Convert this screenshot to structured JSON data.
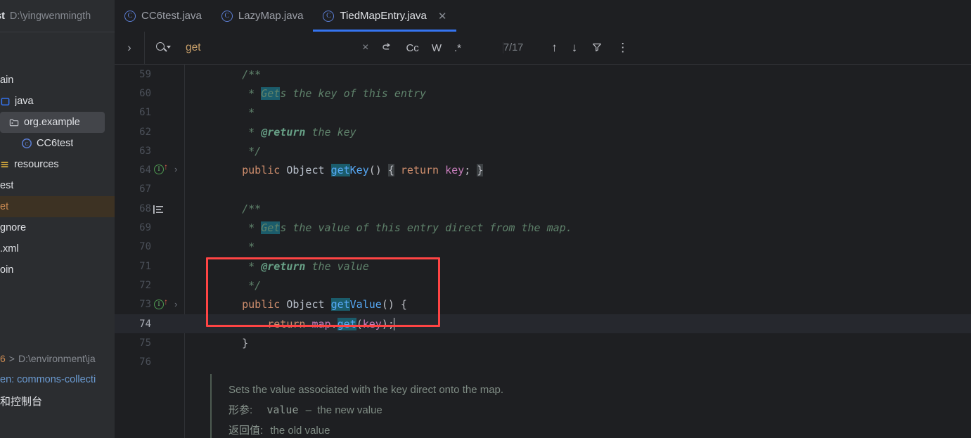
{
  "sidebar": {
    "project_name": "st",
    "project_path": "D:\\yingwenmingth",
    "tree": [
      {
        "label": "ain",
        "icon": "none",
        "indent": 1,
        "state": "normal"
      },
      {
        "label": "java",
        "icon": "source-root",
        "indent": 1,
        "state": "normal"
      },
      {
        "label": "org.example",
        "icon": "package",
        "indent": 2,
        "state": "selected"
      },
      {
        "label": "CC6test",
        "icon": "java-class",
        "indent": 3,
        "state": "normal"
      },
      {
        "label": "resources",
        "icon": "resource-root",
        "indent": 1,
        "state": "normal"
      },
      {
        "label": "est",
        "icon": "none",
        "indent": 1,
        "state": "normal"
      },
      {
        "label": "et",
        "icon": "none",
        "indent": 1,
        "state": "highlighted"
      },
      {
        "label": "gnore",
        "icon": "none",
        "indent": 1,
        "state": "normal"
      },
      {
        "label": ".xml",
        "icon": "none",
        "indent": 1,
        "state": "normal"
      },
      {
        "label": "oin",
        "icon": "none",
        "indent": 1,
        "state": "normal"
      }
    ],
    "run_line": {
      "num": "6",
      "arrow": ">",
      "path": "D:\\environment\\ja"
    },
    "maven_line": "en: commons-collecti",
    "console_line": "和控制台"
  },
  "tabs": [
    {
      "label": "CC6test.java",
      "icon": "java-class-icon",
      "active": false,
      "closable": false
    },
    {
      "label": "LazyMap.java",
      "icon": "java-class-icon",
      "active": false,
      "closable": false
    },
    {
      "label": "TiedMapEntry.java",
      "icon": "java-class-icon",
      "active": true,
      "closable": true
    }
  ],
  "search": {
    "expand_label": "›",
    "query": "get",
    "placeholder": "",
    "clear_label": "×",
    "wrap_label": "wrap-around",
    "match_case_label": "Cc",
    "whole_words_label": "W",
    "regex_label": ".*",
    "match_count": "7/17",
    "prev_label": "↑",
    "next_label": "↓",
    "filter_label": "filter",
    "more_label": "⋮"
  },
  "editor": {
    "lines": [
      {
        "num": "59",
        "gutter": "none",
        "tokens": [
          {
            "t": "    ",
            "c": "pun"
          },
          {
            "t": "/**",
            "c": "cmt"
          }
        ]
      },
      {
        "num": "60",
        "gutter": "none",
        "tokens": [
          {
            "t": "     * ",
            "c": "cmt"
          },
          {
            "t": "Get",
            "c": "cmt hl"
          },
          {
            "t": "s the key of this entry",
            "c": "cmt"
          }
        ]
      },
      {
        "num": "61",
        "gutter": "none",
        "tokens": [
          {
            "t": "     *",
            "c": "cmt"
          }
        ]
      },
      {
        "num": "62",
        "gutter": "none",
        "tokens": [
          {
            "t": "     * ",
            "c": "cmt"
          },
          {
            "t": "@return",
            "c": "tag"
          },
          {
            "t": " the key",
            "c": "cmt"
          }
        ]
      },
      {
        "num": "63",
        "gutter": "none",
        "tokens": [
          {
            "t": "     */",
            "c": "cmt"
          }
        ]
      },
      {
        "num": "64",
        "gutter": "implemented-method",
        "tokens": [
          {
            "t": "    ",
            "c": "pun"
          },
          {
            "t": "public",
            "c": "kw"
          },
          {
            "t": " ",
            "c": "pun"
          },
          {
            "t": "Object",
            "c": "typ"
          },
          {
            "t": " ",
            "c": "pun"
          },
          {
            "t": "get",
            "c": "mth hl"
          },
          {
            "t": "Key",
            "c": "mth"
          },
          {
            "t": "()",
            "c": "pun"
          },
          {
            "t": " ",
            "c": "pun"
          },
          {
            "t": "{",
            "c": "pun brmatch"
          },
          {
            "t": " ",
            "c": "pun"
          },
          {
            "t": "return",
            "c": "kw"
          },
          {
            "t": " ",
            "c": "pun"
          },
          {
            "t": "key",
            "c": "fld"
          },
          {
            "t": ";",
            "c": "pun"
          },
          {
            "t": " ",
            "c": "pun"
          },
          {
            "t": "}",
            "c": "pun brmatch"
          }
        ]
      },
      {
        "num": "67",
        "gutter": "none",
        "tokens": []
      },
      {
        "num": "68",
        "gutter": "javadoc",
        "tokens": [
          {
            "t": "    ",
            "c": "pun"
          },
          {
            "t": "/**",
            "c": "cmt"
          }
        ]
      },
      {
        "num": "69",
        "gutter": "none",
        "tokens": [
          {
            "t": "     * ",
            "c": "cmt"
          },
          {
            "t": "Get",
            "c": "cmt hl"
          },
          {
            "t": "s the value of this entry direct from the map.",
            "c": "cmt"
          }
        ]
      },
      {
        "num": "70",
        "gutter": "none",
        "tokens": [
          {
            "t": "     *",
            "c": "cmt"
          }
        ]
      },
      {
        "num": "71",
        "gutter": "none",
        "tokens": [
          {
            "t": "     * ",
            "c": "cmt"
          },
          {
            "t": "@return",
            "c": "tag"
          },
          {
            "t": " the value",
            "c": "cmt"
          }
        ]
      },
      {
        "num": "72",
        "gutter": "none",
        "tokens": [
          {
            "t": "     */",
            "c": "cmt"
          }
        ]
      },
      {
        "num": "73",
        "gutter": "implemented-method",
        "tokens": [
          {
            "t": "    ",
            "c": "pun"
          },
          {
            "t": "public",
            "c": "kw"
          },
          {
            "t": " ",
            "c": "pun"
          },
          {
            "t": "Object",
            "c": "typ"
          },
          {
            "t": " ",
            "c": "pun"
          },
          {
            "t": "get",
            "c": "mth hl"
          },
          {
            "t": "Value",
            "c": "mth"
          },
          {
            "t": "() {",
            "c": "pun"
          }
        ]
      },
      {
        "num": "74",
        "gutter": "none",
        "current": true,
        "caret": true,
        "tokens": [
          {
            "t": "        ",
            "c": "pun"
          },
          {
            "t": "return",
            "c": "kw"
          },
          {
            "t": " ",
            "c": "pun"
          },
          {
            "t": "map",
            "c": "fld"
          },
          {
            "t": ".",
            "c": "pun"
          },
          {
            "t": "get",
            "c": "mth hl"
          },
          {
            "t": "(",
            "c": "pun"
          },
          {
            "t": "key",
            "c": "fld"
          },
          {
            "t": ");",
            "c": "pun"
          }
        ]
      },
      {
        "num": "75",
        "gutter": "none",
        "tokens": [
          {
            "t": "    }",
            "c": "pun"
          }
        ]
      },
      {
        "num": "76",
        "gutter": "none",
        "tokens": []
      }
    ]
  },
  "doc_tooltip": {
    "summary": "Sets the value associated with the key direct onto the map.",
    "params_label": "形参:",
    "param_name": "value",
    "param_dash": "–",
    "param_desc": "the new value",
    "returns_label": "返回值:",
    "returns_desc": "the old value"
  },
  "colors": {
    "accent": "#3574F0",
    "annotation": "#FF4444",
    "editor_bg": "#1E1F22",
    "sidebar_bg": "#2B2D30",
    "match_highlight": "#1B5C6B",
    "current_line": "#26282E"
  }
}
